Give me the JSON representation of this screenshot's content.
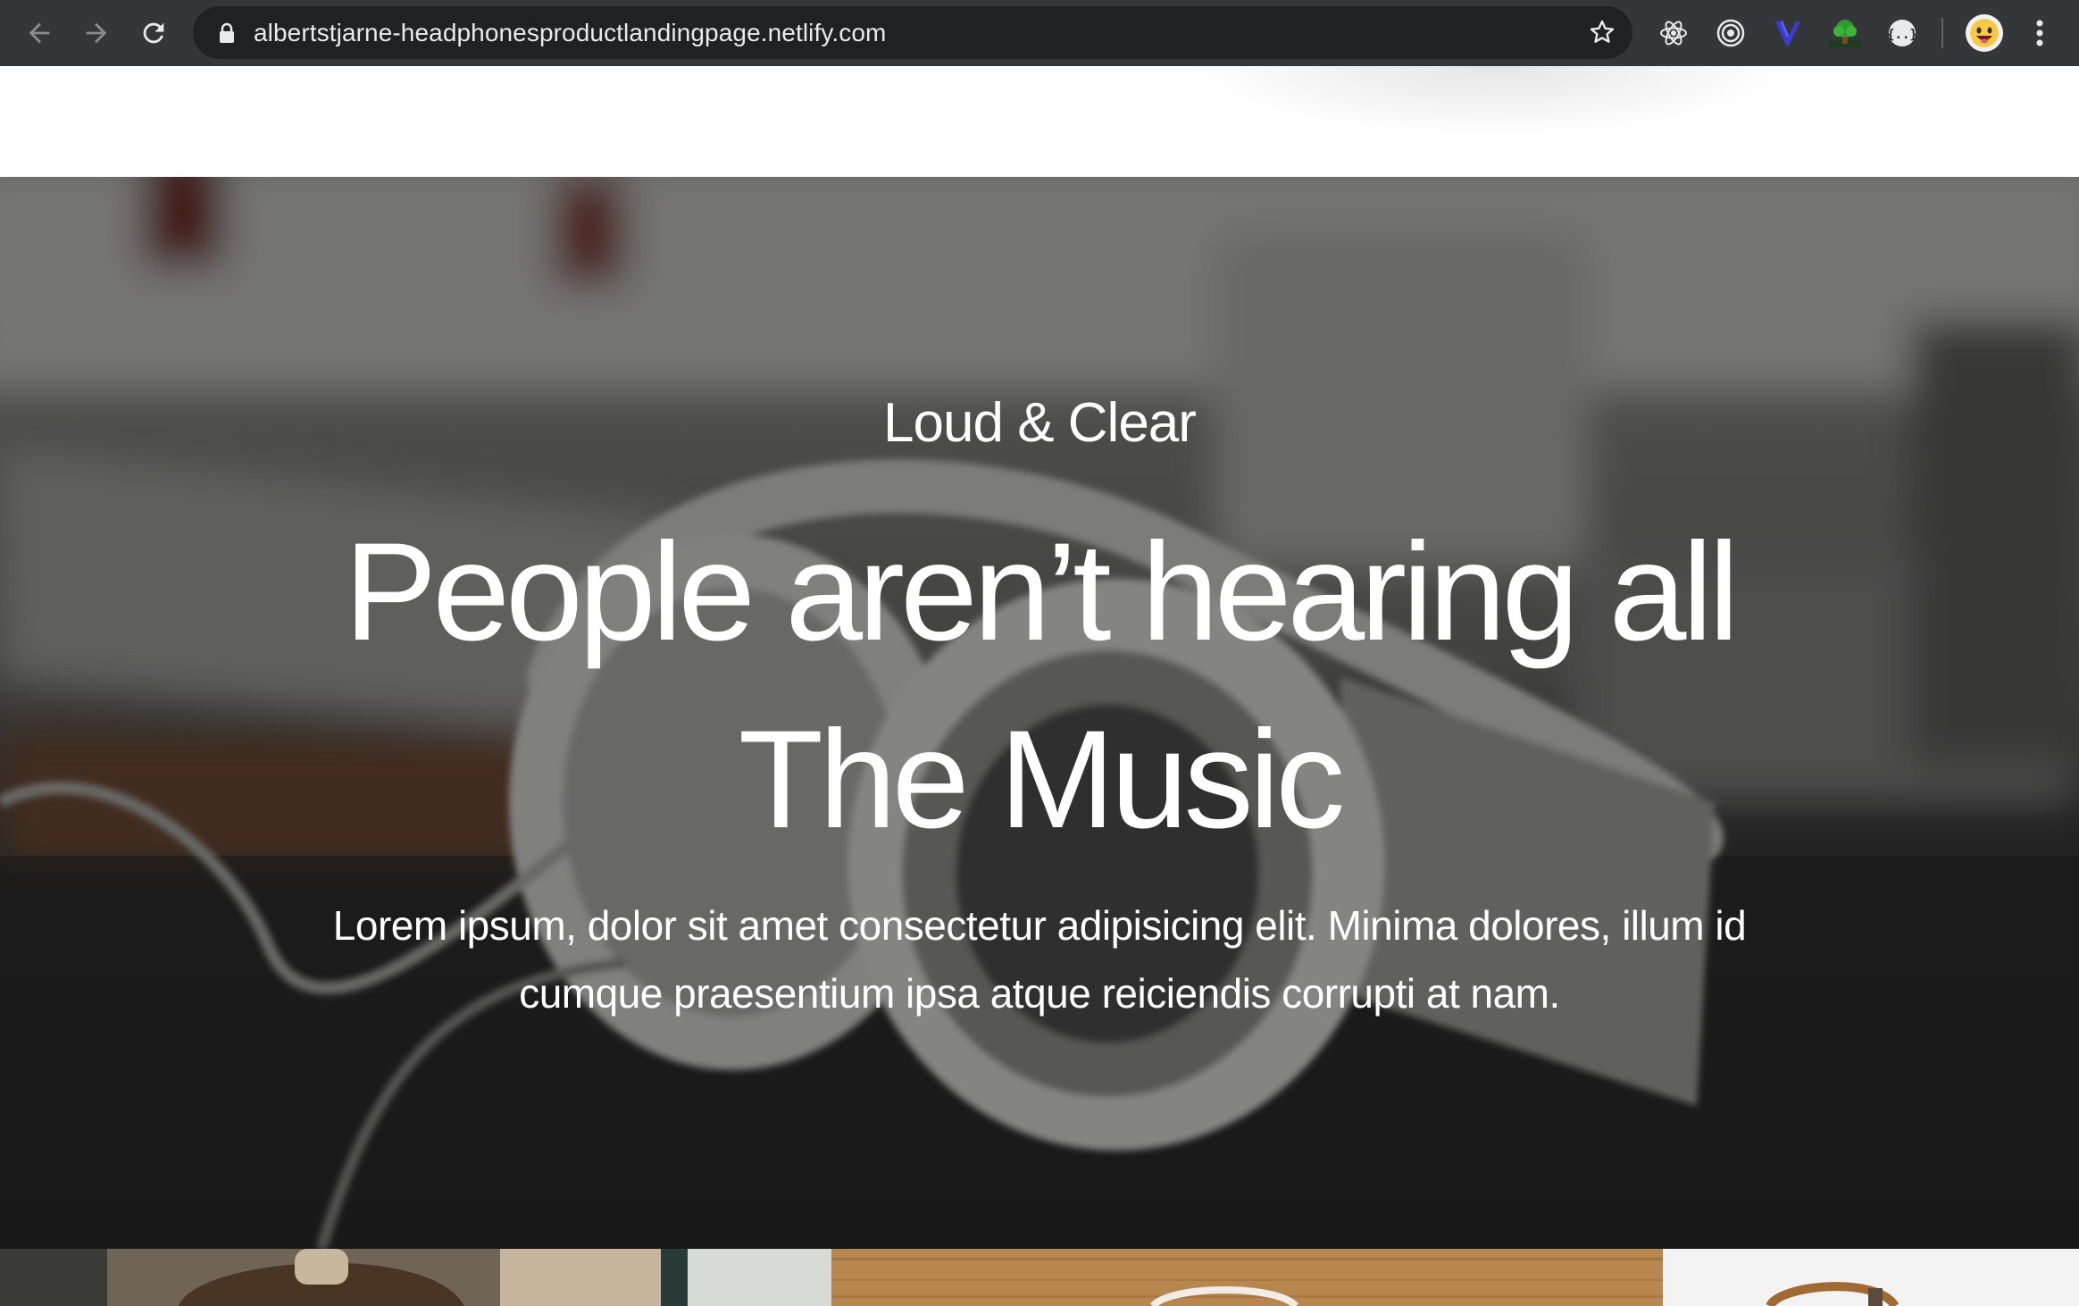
{
  "browser": {
    "url": "albertstjarne-headphonesproductlandingpage.netlify.com",
    "nav_icons": [
      "back-arrow-icon",
      "forward-arrow-icon",
      "reload-icon"
    ],
    "address_icons": [
      "lock-icon",
      "bookmark-star-icon"
    ],
    "extension_icons": [
      "react-devtools-icon",
      "target-extension-icon",
      "vue-devtools-icon",
      "tree-extension-icon",
      "json-extension-icon"
    ],
    "profile_icon": "profile-avatar-icon",
    "menu_icon": "kebab-menu-icon"
  },
  "hero": {
    "eyebrow": "Loud & Clear",
    "title_line1": "People aren’t hearing all",
    "title_line2": "The Music",
    "text": "Lorem ipsum, dolor sit amet consectetur adipisicing elit. Minima dolores, illum id cumque praesentium ipsa atque reiciendis corrupti at nam.",
    "background_image": "headphones-on-desk-photo"
  },
  "gallery": {
    "images": [
      "person-wearing-headphones-photo",
      "headphones-on-wooden-table-photo",
      "headphones-on-white-background-photo"
    ]
  },
  "colors": {
    "chrome_bg": "#35363a",
    "omnibox_bg": "#202124",
    "hero_text": "#ffffff"
  }
}
